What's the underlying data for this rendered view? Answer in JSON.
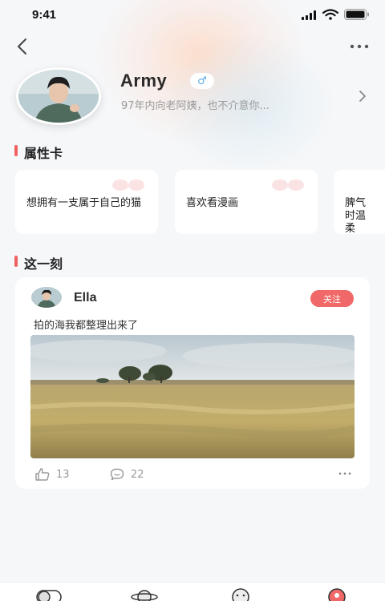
{
  "status_bar": {
    "time": "9:41"
  },
  "profile": {
    "name": "Army",
    "gender_symbol": "♂",
    "bio": "97年内向老阿姨，也不介意你..."
  },
  "sections": {
    "attributes_title": "属性卡",
    "moment_title": "这一刻"
  },
  "attribute_cards": [
    {
      "text": "想拥有一支属于自己的猫"
    },
    {
      "text": "喜欢看漫画"
    },
    {
      "text": "脾气时温柔"
    }
  ],
  "post": {
    "username": "Ella",
    "follow_label": "关注",
    "text": "拍的海我都整理出来了",
    "likes": "13",
    "comments": "22"
  },
  "tabs": [
    {
      "icon": "toggle-icon"
    },
    {
      "icon": "planet-icon"
    },
    {
      "icon": "face-icon"
    },
    {
      "icon": "profile-icon"
    }
  ],
  "colors": {
    "accent": "#f06868",
    "background": "#f6f7f9",
    "gender": "#5aa9e6"
  }
}
